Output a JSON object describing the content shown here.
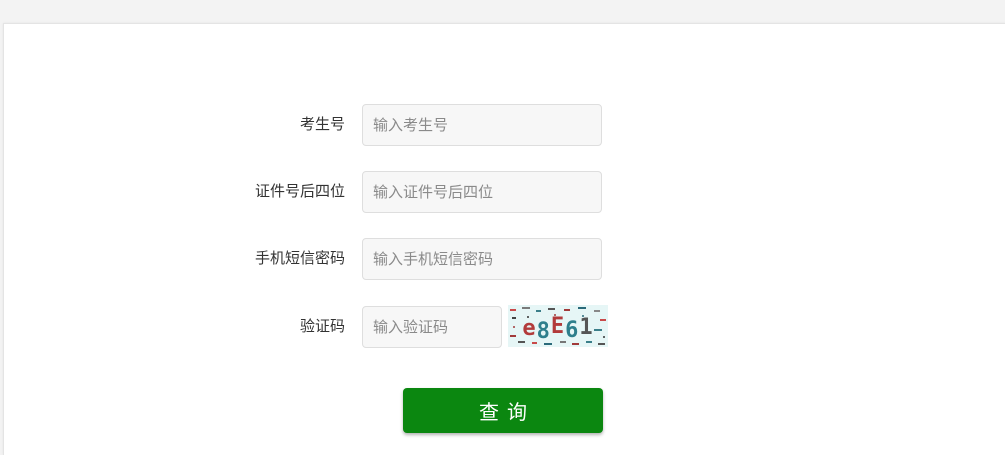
{
  "form": {
    "fields": [
      {
        "label": "考生号",
        "placeholder": "输入考生号"
      },
      {
        "label": "证件号后四位",
        "placeholder": "输入证件号后四位"
      },
      {
        "label": "手机短信密码",
        "placeholder": "输入手机短信密码"
      },
      {
        "label": "验证码",
        "placeholder": "输入验证码"
      }
    ],
    "captcha_text": "e8E61",
    "submit_label": "查询"
  },
  "colors": {
    "page_background": "#f3f3f3",
    "panel_background": "#ffffff",
    "input_background": "#f7f7f7",
    "submit_background": "#0b8710",
    "submit_text": "#ffffff"
  }
}
